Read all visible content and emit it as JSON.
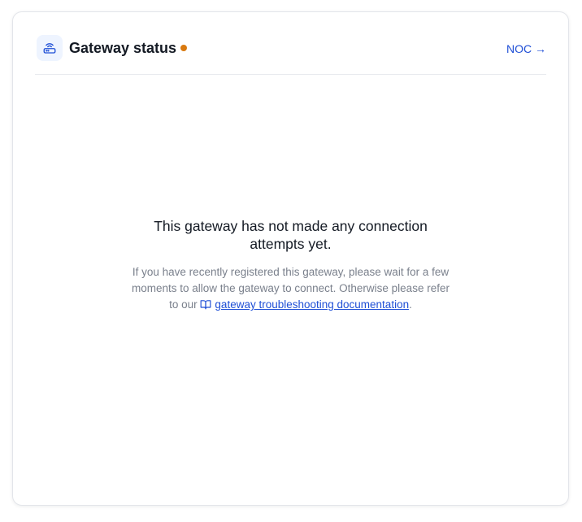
{
  "card": {
    "title": "Gateway status",
    "status_color": "#d9790f",
    "header_icon": "router-icon",
    "noc_link_label": "NOC →"
  },
  "empty_state": {
    "heading": "This gateway has not made any connection attempts yet.",
    "description_prefix": "If you have recently registered this gateway, please wait for a few moments to allow the gateway to connect. Otherwise please refer to our",
    "link_icon": "book-icon",
    "link_label": "gateway troubleshooting documentation",
    "description_suffix": "."
  }
}
